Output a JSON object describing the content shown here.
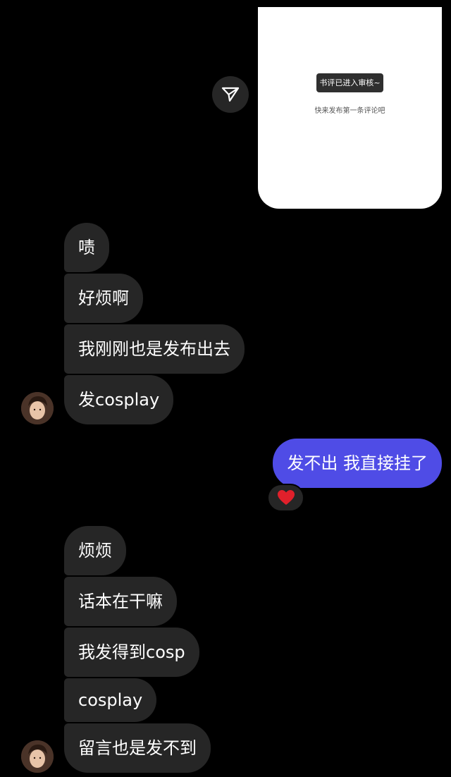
{
  "shared_card": {
    "toast": "书评已进入审核~",
    "empty_hint": "快来发布第一条评论吧"
  },
  "icons": {
    "share": "send-icon",
    "reaction": "red-heart-icon",
    "avatar": "user-avatar-photo"
  },
  "colors": {
    "background": "#000000",
    "incoming_bubble": "#262626",
    "outgoing_bubble": "#4f4ce6",
    "heart": "#e0202b"
  },
  "thread": {
    "group1": [
      "啧",
      "好烦啊",
      "我刚刚也是发布出去",
      "发cosplay"
    ],
    "outgoing": "发不出 我直接挂了",
    "group2": [
      "烦烦",
      "话本在干嘛",
      "我发得到cosp",
      "cosplay",
      "留言也是发不到"
    ]
  }
}
